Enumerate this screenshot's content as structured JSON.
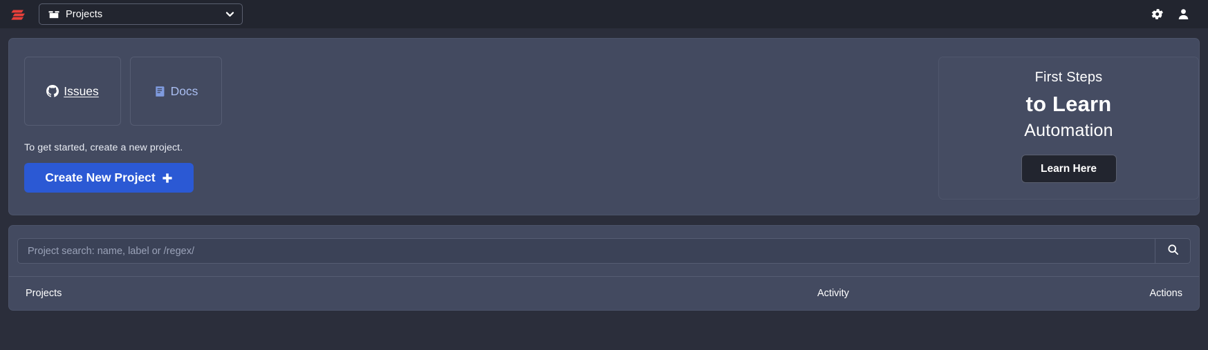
{
  "topbar": {
    "logo_name": "logo-mark",
    "logo_color": "#e8403a",
    "project_selector": {
      "label": "Projects",
      "icon": "box-icon",
      "chevron": "chevron-down-icon"
    },
    "icons": [
      {
        "name": "gear-icon",
        "title": "Settings"
      },
      {
        "name": "user-icon",
        "title": "Account"
      }
    ]
  },
  "hero": {
    "quicklinks": [
      {
        "label": "Issues",
        "icon": "github-icon"
      },
      {
        "label": "Docs",
        "icon": "book-icon"
      }
    ],
    "get_started_text": "To get started, create a new project.",
    "create_button": {
      "label": "Create New Project",
      "icon": "plus-icon",
      "color": "#2b59d4"
    }
  },
  "first_steps": {
    "line1": "First Steps",
    "line2": "to Learn",
    "line3": "Automation",
    "button_label": "Learn Here"
  },
  "search": {
    "placeholder": "Project search: name, label or /regex/",
    "value": "",
    "button_icon": "search-icon"
  },
  "table": {
    "columns": [
      {
        "key": "projects",
        "label": "Projects"
      },
      {
        "key": "activity",
        "label": "Activity"
      },
      {
        "key": "actions",
        "label": "Actions"
      }
    ],
    "rows": []
  },
  "theme": {
    "page_bg": "#2b2e3b",
    "panel_bg": "#434a60",
    "topbar_bg": "#22252f",
    "accent_blue": "#2b59d4",
    "logo_red": "#e8403a"
  }
}
